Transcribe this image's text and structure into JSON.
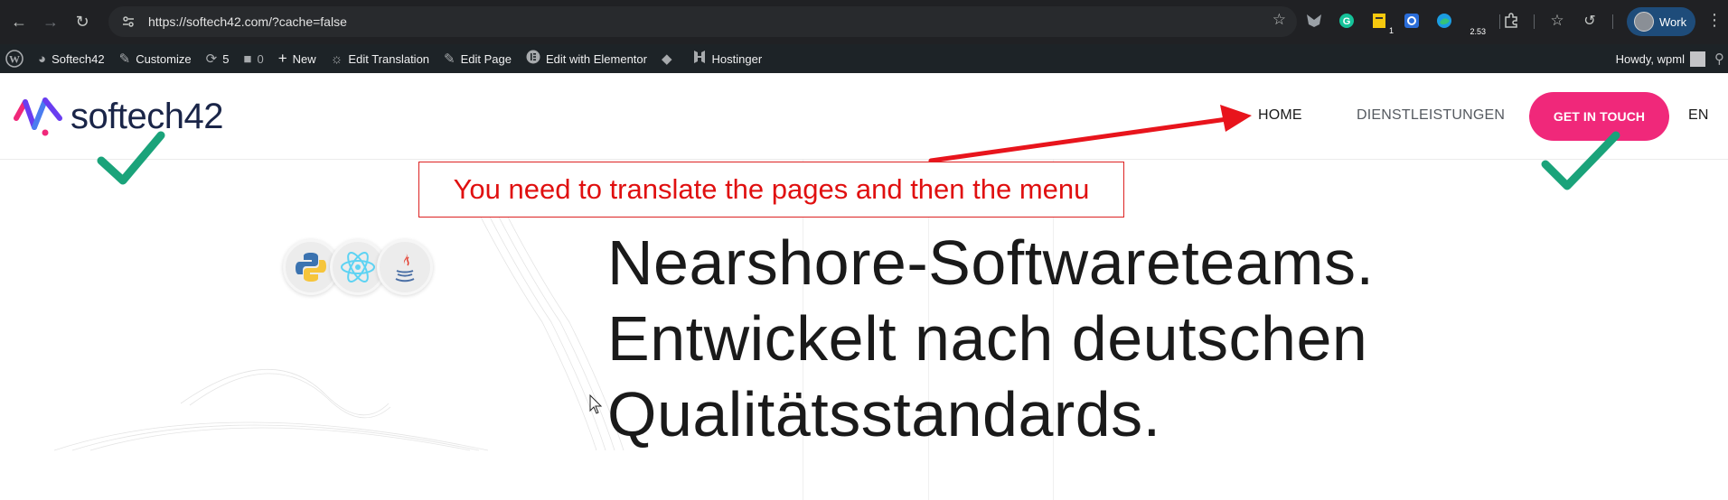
{
  "browser": {
    "url": "https://softech42.com/?cache=false",
    "extension_badge_value": "2.53",
    "extension_badge_count": "1",
    "profile_label": "Work"
  },
  "admin_bar": {
    "site_name": "Softech42",
    "customize": "Customize",
    "updates_count": "5",
    "comments_count": "0",
    "new": "New",
    "edit_translation": "Edit Translation",
    "edit_page": "Edit Page",
    "edit_with_elementor": "Edit with Elementor",
    "hostinger": "Hostinger",
    "howdy": "Howdy, wpml"
  },
  "site": {
    "logo_text": "softech42",
    "nav": {
      "home": "HOME",
      "services": "DIENSTLEISTUNGEN",
      "cta": "GET IN TOUCH",
      "lang": "EN"
    },
    "hero_lines": [
      "Nearshore-Softwareteams.",
      "Entwickelt nach deutschen",
      "Qualitätsstandards."
    ],
    "tech_icons": [
      "python-icon",
      "react-icon",
      "java-icon"
    ],
    "brand_pink": "#f0287a",
    "brand_navy": "#1a2548"
  },
  "annotation": {
    "text": "You need to translate the pages and then the menu",
    "color": "#e01010",
    "checkmark_color": "#1aa37a"
  }
}
